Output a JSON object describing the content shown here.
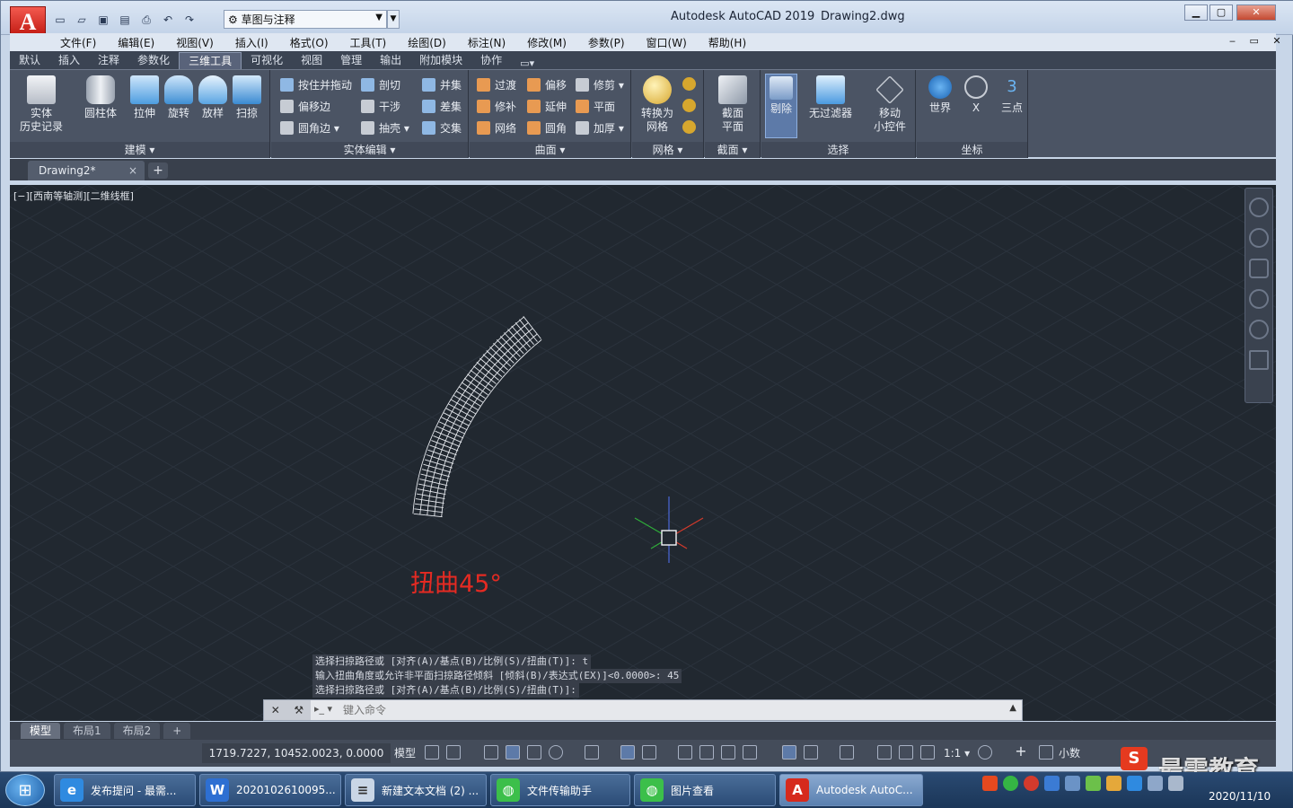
{
  "titlebar": {
    "app_title": "Autodesk AutoCAD 2019",
    "doc_title": "Drawing2.dwg",
    "workspace": "草图与注释",
    "logo_letter": "A"
  },
  "menubar": [
    "文件(F)",
    "编辑(E)",
    "视图(V)",
    "插入(I)",
    "格式(O)",
    "工具(T)",
    "绘图(D)",
    "标注(N)",
    "修改(M)",
    "参数(P)",
    "窗口(W)",
    "帮助(H)"
  ],
  "ribbon_tabs": [
    "默认",
    "插入",
    "注释",
    "参数化",
    "三维工具",
    "可视化",
    "视图",
    "管理",
    "输出",
    "附加模块",
    "协作"
  ],
  "active_ribbon_tab": "三维工具",
  "panels": {
    "modeling": {
      "title": "建模 ▾",
      "buttons": [
        "实体历史记录",
        "圆柱体",
        "拉伸",
        "旋转",
        "放样",
        "扫掠"
      ],
      "button_lines": [
        [
          "实体",
          "历史记录"
        ],
        [
          "圆柱体",
          ""
        ],
        [
          "拉伸",
          ""
        ],
        [
          "旋转",
          ""
        ],
        [
          "放样",
          ""
        ],
        [
          "扫掠",
          ""
        ]
      ]
    },
    "solid_edit": {
      "title": "实体编辑 ▾",
      "items": [
        "按住并拖动",
        "偏移边",
        "圆角边 ▾",
        "剖切",
        "干涉",
        "抽壳 ▾",
        "并集",
        "差集",
        "交集"
      ]
    },
    "surface": {
      "title": "曲面 ▾",
      "items": [
        "过渡",
        "修补",
        "网络",
        "偏移",
        "延伸",
        "圆角",
        "修剪 ▾",
        "平面",
        "加厚 ▾"
      ]
    },
    "mesh": {
      "title": "网格 ▾",
      "button_line1": "转换为",
      "button_line2": "网格"
    },
    "section": {
      "title": "截面 ▾",
      "button_line1": "截面",
      "button_line2": "平面"
    },
    "selection": {
      "title": "选择",
      "cull": "剔除",
      "no_filter": "无过滤器",
      "gizmo_line1": "移动",
      "gizmo_line2": "小控件"
    },
    "coordinates": {
      "title": "坐标",
      "buttons": [
        "世界",
        "X",
        "三点"
      ]
    }
  },
  "file_tab": {
    "name": "Drawing2*",
    "close": "×",
    "new": "+"
  },
  "viewport_label": "[−][西南等轴测][二维线框]",
  "annotation": "扭曲45°",
  "command_history": [
    "选择扫掠路径或 [对齐(A)/基点(B)/比例(S)/扭曲(T)]: t",
    "输入扭曲角度或允许非平面扫掠路径倾斜 [倾斜(B)/表达式(EX)]<0.0000>: 45",
    "选择扫掠路径或 [对齐(A)/基点(B)/比例(S)/扭曲(T)]:"
  ],
  "command_input_placeholder": "键入命令",
  "layout_tabs": [
    "模型",
    "布局1",
    "布局2",
    "+"
  ],
  "active_layout": "模型",
  "statusbar": {
    "coords": "1719.7227, 10452.0023, 0.0000",
    "model": "模型",
    "scale": "1:1 ▾",
    "units": "小数"
  },
  "taskbar": {
    "items": [
      {
        "label": "发布提问 - 最需...",
        "icon": "ie-icon",
        "letter": "e"
      },
      {
        "label": "2020102610095...",
        "icon": "w-icon",
        "letter": "W"
      },
      {
        "label": "新建文本文档 (2) ...",
        "icon": "notepad-icon",
        "letter": "≡"
      },
      {
        "label": "文件传输助手",
        "icon": "wechat-icon",
        "letter": "◍"
      },
      {
        "label": "图片查看",
        "icon": "wechat-icon",
        "letter": "◍"
      },
      {
        "label": "Autodesk AutoC...",
        "icon": "autocad-icon",
        "letter": "A"
      }
    ],
    "clock_date": "2020/11/10"
  },
  "watermark": "最需教育",
  "colors": {
    "canvas_bg": "#212830",
    "annotation": "#e52a22",
    "ribbon_bg": "#4b5464"
  }
}
